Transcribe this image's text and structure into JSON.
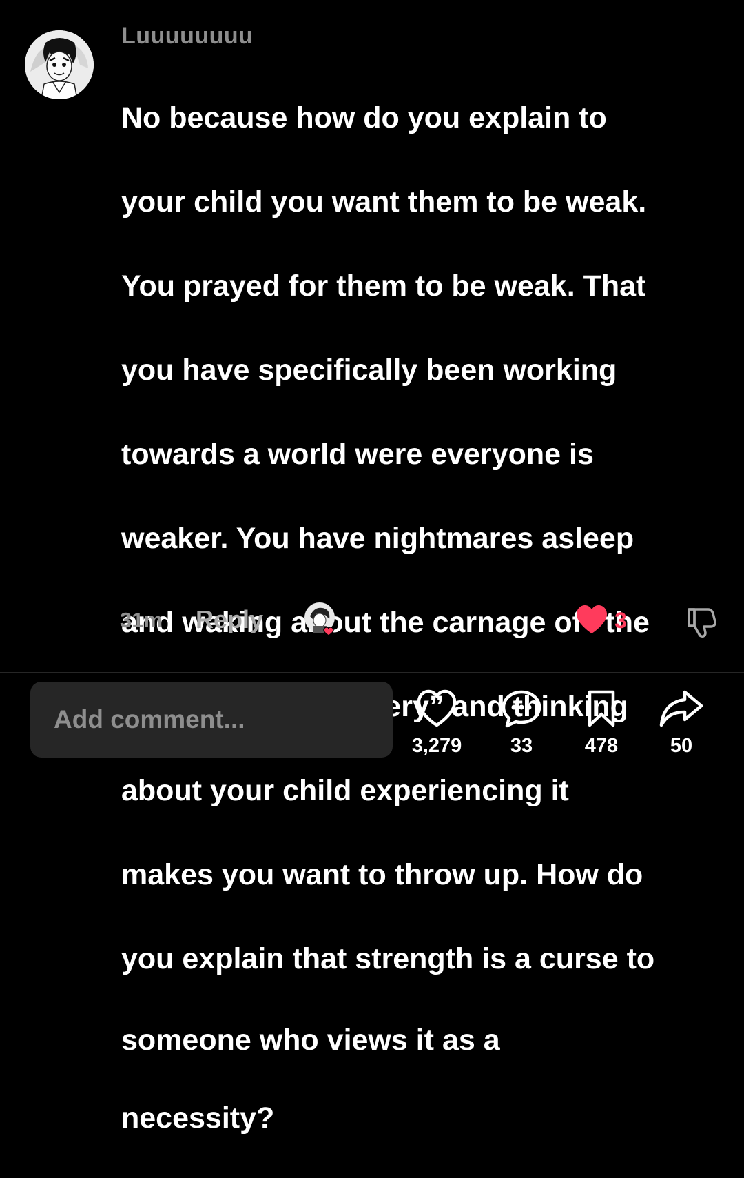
{
  "comment": {
    "username": "Luuuuuuuu",
    "lines": [
      "No because how do you explain to",
      "your child you want them to be weak.",
      "You prayed for them to be weak. That",
      "you have specifically been working",
      "towards a world were everyone is",
      "weaker. You have nightmares asleep",
      "and waking about the carnage of “the",
      "golden age of sorcery” and thinking",
      "about your child experiencing it",
      "makes you want to throw up. How do",
      "you explain that strength is a curse to",
      "someone who views it as a",
      "necessity?"
    ],
    "time": "31m",
    "reply_label": "Reply",
    "like_count": "3",
    "like_color": "#ff3b5c"
  },
  "composer": {
    "placeholder": "Add comment..."
  },
  "actions": {
    "likes": "3,279",
    "comments": "33",
    "saves": "478",
    "shares": "50"
  },
  "icons": [
    "avatar",
    "liked-by-author-avatar",
    "heart-icon",
    "dislike-icon",
    "like-icon",
    "comment-icon",
    "bookmark-icon",
    "share-icon"
  ]
}
